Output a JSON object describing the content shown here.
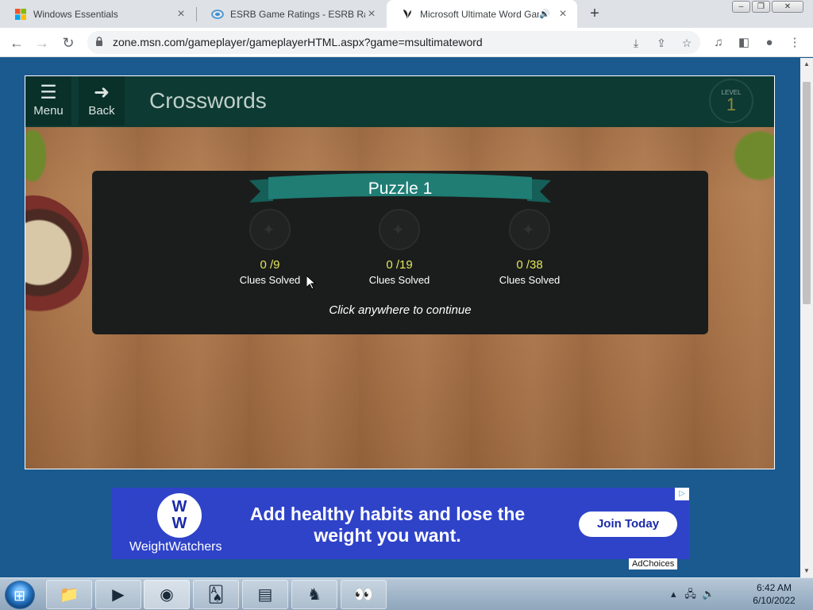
{
  "browser": {
    "tabs": [
      {
        "title": "Windows Essentials",
        "active": false
      },
      {
        "title": "ESRB Game Ratings - ESRB Ratin",
        "active": false
      },
      {
        "title": "Microsoft Ultimate Word Game",
        "active": true
      }
    ],
    "new_tab": "+",
    "url": "zone.msn.com/gameplayer/gameplayerHTML.aspx?game=msultimateword"
  },
  "game": {
    "menu_label": "Menu",
    "back_label": "Back",
    "title": "Crosswords",
    "level_label": "LEVEL",
    "level_value": "1",
    "puzzle": {
      "title": "Puzzle 1",
      "stats": [
        {
          "count": "0 /9",
          "label": "Clues Solved"
        },
        {
          "count": "0 /19",
          "label": "Clues Solved"
        },
        {
          "count": "0 /38",
          "label": "Clues Solved"
        }
      ],
      "continue_text": "Click anywhere to continue"
    }
  },
  "ad": {
    "brand": "WeightWatchers",
    "logo_top": "W",
    "logo_bottom": "W",
    "headline": "Add healthy habits and lose the weight you want.",
    "cta": "Join Today",
    "adchoices": "AdChoices"
  },
  "taskbar": {
    "time": "6:42 AM",
    "date": "6/10/2022"
  },
  "colors": {
    "page_bg": "#1b5a8f",
    "header_bg": "#0d3a33",
    "panel_bg": "#1b1d1c",
    "ribbon": "#1f7d74",
    "count_yellow": "#e3e65a",
    "ad_bg": "#2f43c9"
  }
}
